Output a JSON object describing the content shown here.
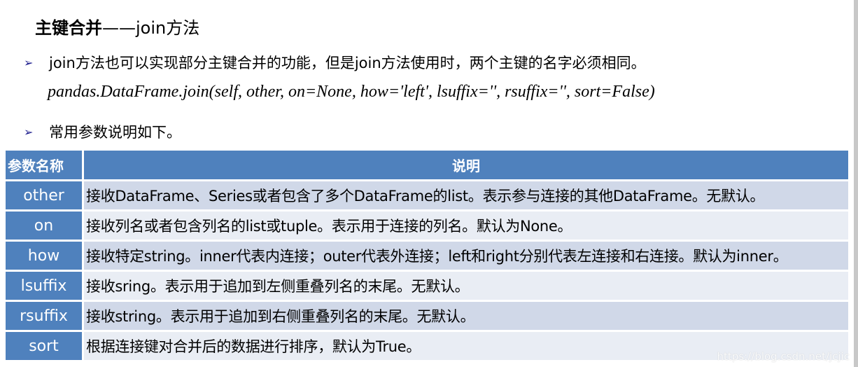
{
  "title": {
    "bold": "主键合并",
    "rest": "——join方法"
  },
  "bullets": [
    "join方法也可以实现部分主键合并的功能，但是join方法使用时，两个主键的名字必须相同。",
    "常用参数说明如下。"
  ],
  "signature": "pandas.DataFrame.join(self, other, on=None, how='left', lsuffix='', rsuffix='', sort=False)",
  "table": {
    "headers": [
      "参数名称",
      "说明"
    ],
    "rows": [
      {
        "name": "other",
        "desc": "接收DataFrame、Series或者包含了多个DataFrame的list。表示参与连接的其他DataFrame。无默认。"
      },
      {
        "name": "on",
        "desc": "接收列名或者包含列名的list或tuple。表示用于连接的列名。默认为None。"
      },
      {
        "name": "how",
        "desc": "接收特定string。inner代表内连接；outer代表外连接；left和right分别代表左连接和右连接。默认为inner。"
      },
      {
        "name": "lsuffix",
        "desc": "接收sring。表示用于追加到左侧重叠列名的末尾。无默认。"
      },
      {
        "name": "rsuffix",
        "desc": "接收string。表示用于追加到右侧重叠列名的末尾。无默认。"
      },
      {
        "name": "sort",
        "desc": "根据连接键对合并后的数据进行排序，默认为True。"
      }
    ]
  },
  "watermark": "https://blog.csdn.net/jcjic",
  "colors": {
    "header": "#4f81bd",
    "row_dark": "#d0d8e8",
    "row_light": "#e9edf4",
    "bullet": "#1a1a8c"
  }
}
